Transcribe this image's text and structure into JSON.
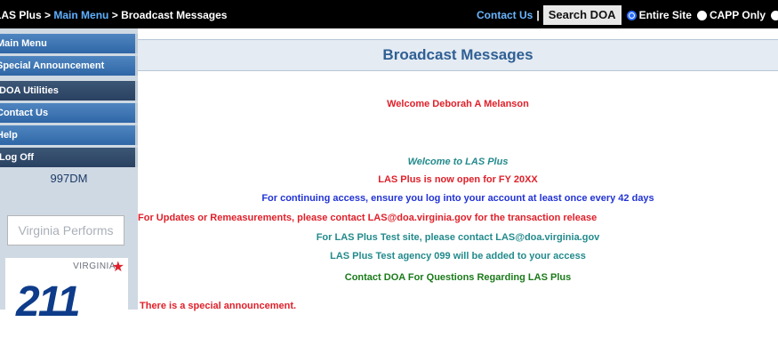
{
  "breadcrumb": {
    "item1": "LAS Plus",
    "sep1": ">",
    "item2": "Main Menu",
    "sep2": ">",
    "current": "Broadcast Messages"
  },
  "topbar": {
    "contact_us": "Contact Us",
    "pipe": "|",
    "search_label": "Search DOA",
    "radio_entire_site": "Entire Site",
    "radio_capp_only": "CAPP Only",
    "selected_scope": "Entire Site"
  },
  "sidebar": {
    "items": [
      {
        "label": "Main Menu"
      },
      {
        "label": "Special Announcement"
      },
      {
        "label": "DOA Utilities"
      },
      {
        "label": "Contact Us"
      },
      {
        "label": "Help"
      },
      {
        "label": "Log Off"
      }
    ],
    "agency_code": "997DM",
    "virginia_performs_logo": "Virginia Performs",
    "logo_211_state": "VIRGINIA",
    "logo_211_number": "211"
  },
  "main": {
    "title": "Broadcast Messages",
    "welcome_user": "Welcome Deborah A Melanson",
    "messages": [
      "Welcome to LAS Plus",
      "LAS Plus is now open for FY 20XX",
      "For continuing access, ensure you log into your account at least once every 42 days",
      "For Updates or Remeasurements, please contact LAS@doa.virginia.gov for the transaction release",
      "For LAS Plus Test site, please contact LAS@doa.virginia.gov",
      "LAS Plus Test agency 099 will be added to your access",
      "Contact DOA For Questions Regarding LAS Plus"
    ],
    "special_announcement": "There is a special announcement."
  },
  "colors": {
    "topbar_bg": "#000000",
    "link_blue": "#5fb0ff",
    "menu_blue": "#2f66a6",
    "header_text": "#2f5f94",
    "red": "#e0202a",
    "teal": "#238a8c",
    "blue": "#2233d6",
    "green": "#1a7a1a"
  }
}
